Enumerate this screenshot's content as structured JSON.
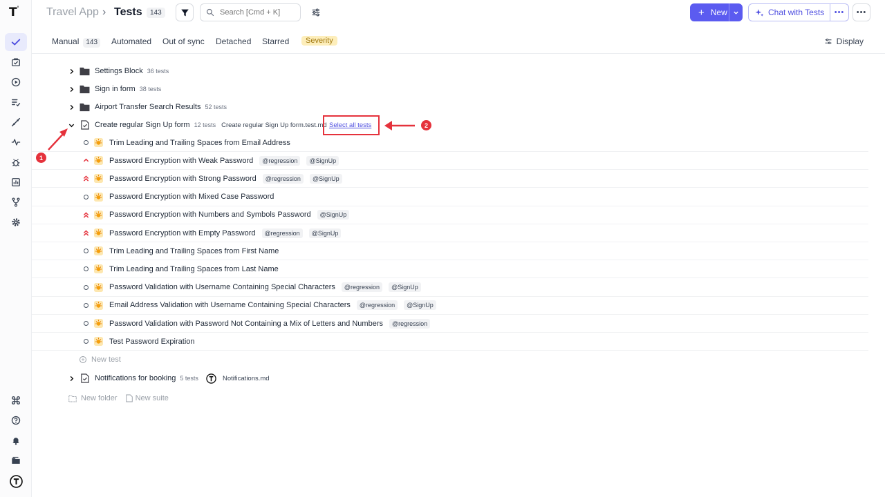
{
  "topbar": {
    "app_name": "Travel App",
    "separator": "›",
    "title": "Tests",
    "count": "143",
    "search_placeholder": "Search [Cmd + K]",
    "new_label": "New",
    "chat_label": "Chat with Tests"
  },
  "tabs": {
    "manual": "Manual",
    "manual_count": "143",
    "automated": "Automated",
    "out_of_sync": "Out of sync",
    "detached": "Detached",
    "starred": "Starred",
    "severity": "Severity",
    "display": "Display"
  },
  "tree": {
    "folders": [
      {
        "name": "Settings Block",
        "meta": "36 tests"
      },
      {
        "name": "Sign in form",
        "meta": "38 tests"
      },
      {
        "name": "Airport Transfer Search Results",
        "meta": "52 tests"
      }
    ],
    "open_suite": {
      "name": "Create regular Sign Up form",
      "meta": "12 tests",
      "file": "Create regular Sign Up form.test.md",
      "select_all": "Select all tests"
    },
    "tests": [
      {
        "name": "Trim Leading and Trailing Spaces from Email Address",
        "priority": "normal",
        "tags": []
      },
      {
        "name": "Password Encryption with Weak Password",
        "priority": "high",
        "tags": [
          "@regression",
          "@SignUp"
        ]
      },
      {
        "name": "Password Encryption with Strong Password",
        "priority": "critical",
        "tags": [
          "@regression",
          "@SignUp"
        ]
      },
      {
        "name": "Password Encryption with Mixed Case Password",
        "priority": "normal",
        "tags": []
      },
      {
        "name": "Password Encryption with Numbers and Symbols Password",
        "priority": "critical",
        "tags": [
          "@SignUp"
        ]
      },
      {
        "name": "Password Encryption with Empty Password",
        "priority": "critical",
        "tags": [
          "@regression",
          "@SignUp"
        ]
      },
      {
        "name": "Trim Leading and Trailing Spaces from First Name",
        "priority": "normal",
        "tags": []
      },
      {
        "name": "Trim Leading and Trailing Spaces from Last Name",
        "priority": "normal",
        "tags": []
      },
      {
        "name": "Password Validation with Username Containing Special Characters",
        "priority": "normal",
        "tags": [
          "@regression",
          "@SignUp"
        ]
      },
      {
        "name": "Email Address Validation with Username Containing Special Characters",
        "priority": "normal",
        "tags": [
          "@regression",
          "@SignUp"
        ]
      },
      {
        "name": "Password Validation with Password Not Containing a Mix of Letters and Numbers",
        "priority": "normal",
        "tags": [
          "@regression"
        ]
      },
      {
        "name": "Test Password Expiration",
        "priority": "normal",
        "tags": []
      }
    ],
    "new_test": "New test",
    "next_suite": {
      "name": "Notifications for booking",
      "meta": "5 tests",
      "file": "Notifications.md"
    },
    "new_folder": "New folder",
    "new_suite": "New suite"
  },
  "annotations": {
    "one": "1",
    "two": "2"
  },
  "colors": {
    "accent": "#5b5bf0",
    "annotation": "#e5323c",
    "priority_high": "#e5323c"
  }
}
